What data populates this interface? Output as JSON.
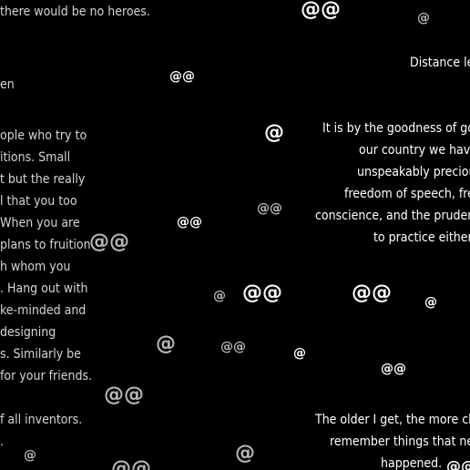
{
  "colors": {
    "background": "#000000",
    "text_left": "#d4d4d4",
    "text_right": "#ffffff",
    "at_bright": "#ffffff",
    "at_dim": "#b8b8b8"
  },
  "left_lines": [
    "there would be no heroes.",
    "en",
    "ople who try to",
    "itions. Small",
    "t but the really",
    "l that you too",
    "When you are",
    "plans to fruition",
    "h whom you",
    ". Hang out with",
    "ke-minded and",
    "designing",
    "s. Similarly be",
    "for your friends.",
    "f all inventors.",
    "."
  ],
  "right_lines": [
    "Distance le",
    "It is by the goodness of goo",
    "our country we have",
    "unspeakably preciou",
    "freedom of speech, free",
    "conscience, and the prudenc",
    "to practice either",
    "The older I get, the more cle",
    "remember things that nev",
    "happened."
  ],
  "at_marks": [
    "@@",
    "@",
    "@@",
    "@",
    "@@",
    "@@",
    "@@",
    "@@",
    "@",
    "@@",
    "@",
    "@",
    "@@",
    "@@",
    "@",
    "@@",
    "@@",
    "@",
    "@",
    "@@"
  ]
}
